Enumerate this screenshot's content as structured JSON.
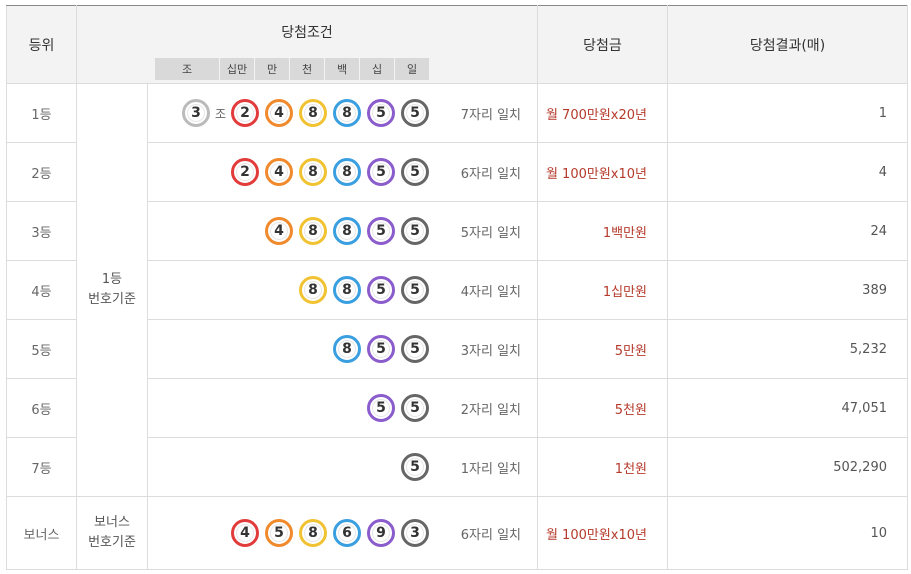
{
  "headers": {
    "rank": "등위",
    "condition": "당첨조건",
    "prize": "당첨금",
    "result": "당첨결과(매)",
    "digits": [
      "조",
      "십만",
      "만",
      "천",
      "백",
      "십",
      "일"
    ]
  },
  "basis_main": [
    "1등",
    "번호기준"
  ],
  "basis_bonus": [
    "보너스",
    "번호기준"
  ],
  "jo_label": "조",
  "rows": [
    {
      "rank": "1등",
      "jo": "3",
      "balls": [
        "2",
        "4",
        "8",
        "8",
        "5",
        "5"
      ],
      "colors": [
        "red",
        "orange",
        "yellow",
        "blue",
        "purple",
        "gray"
      ],
      "match": "7자리 일치",
      "prize": "월 700만원x20년",
      "count": "1"
    },
    {
      "rank": "2등",
      "balls": [
        "2",
        "4",
        "8",
        "8",
        "5",
        "5"
      ],
      "colors": [
        "red",
        "orange",
        "yellow",
        "blue",
        "purple",
        "gray"
      ],
      "match": "6자리 일치",
      "prize": "월 100만원x10년",
      "count": "4"
    },
    {
      "rank": "3등",
      "balls": [
        "4",
        "8",
        "8",
        "5",
        "5"
      ],
      "colors": [
        "orange",
        "yellow",
        "blue",
        "purple",
        "gray"
      ],
      "match": "5자리 일치",
      "prize": "1백만원",
      "count": "24"
    },
    {
      "rank": "4등",
      "balls": [
        "8",
        "8",
        "5",
        "5"
      ],
      "colors": [
        "yellow",
        "blue",
        "purple",
        "gray"
      ],
      "match": "4자리 일치",
      "prize": "1십만원",
      "count": "389"
    },
    {
      "rank": "5등",
      "balls": [
        "8",
        "5",
        "5"
      ],
      "colors": [
        "blue",
        "purple",
        "gray"
      ],
      "match": "3자리 일치",
      "prize": "5만원",
      "count": "5,232"
    },
    {
      "rank": "6등",
      "balls": [
        "5",
        "5"
      ],
      "colors": [
        "purple",
        "gray"
      ],
      "match": "2자리 일치",
      "prize": "5천원",
      "count": "47,051"
    },
    {
      "rank": "7등",
      "balls": [
        "5"
      ],
      "colors": [
        "gray"
      ],
      "match": "1자리 일치",
      "prize": "1천원",
      "count": "502,290"
    }
  ],
  "bonus": {
    "rank": "보너스",
    "balls": [
      "4",
      "5",
      "8",
      "6",
      "9",
      "3"
    ],
    "colors": [
      "red",
      "orange",
      "yellow",
      "blue",
      "purple",
      "gray"
    ],
    "match": "6자리 일치",
    "prize": "월 100만원x10년",
    "count": "10"
  },
  "colors": {
    "red": "#e23b3b",
    "orange": "#f08a2c",
    "yellow": "#f1c232",
    "blue": "#3a9fe0",
    "purple": "#8a5ccc",
    "gray": "#666666",
    "prize_text": "#b53a2b"
  }
}
